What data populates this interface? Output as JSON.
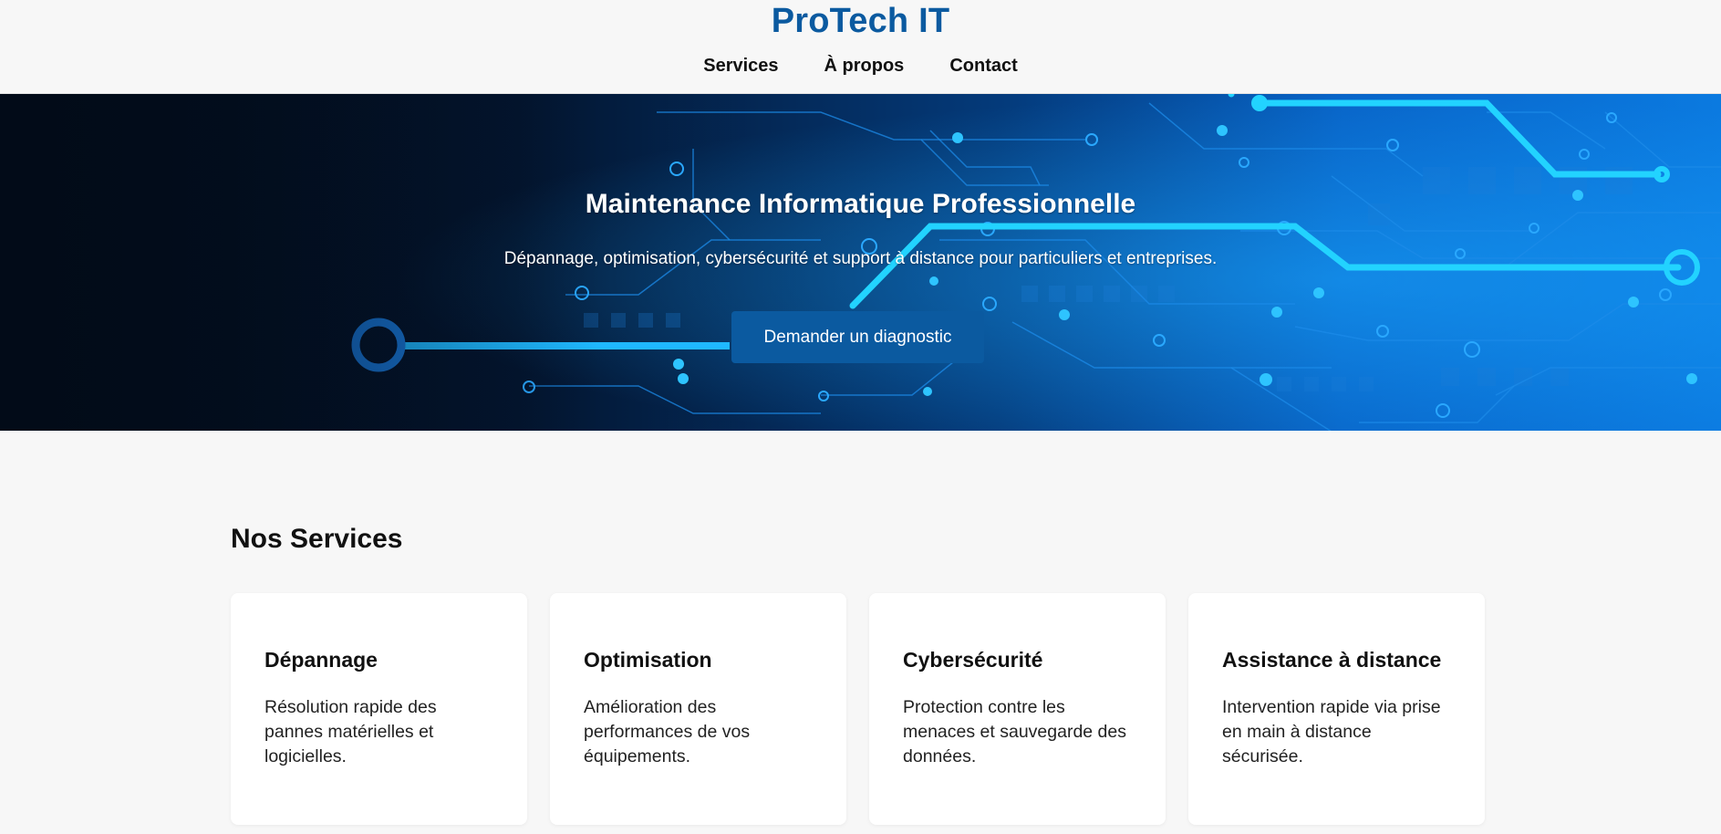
{
  "header": {
    "brand": "ProTech IT",
    "nav": [
      {
        "label": "Services"
      },
      {
        "label": "À propos"
      },
      {
        "label": "Contact"
      }
    ]
  },
  "hero": {
    "title": "Maintenance Informatique Professionnelle",
    "subtitle": "Dépannage, optimisation, cybersécurité et support à distance pour particuliers et entreprises.",
    "cta_label": "Demander un diagnostic",
    "background": "circuit-board-illustration"
  },
  "services": {
    "title": "Nos Services",
    "cards": [
      {
        "title": "Dépannage",
        "text": "Résolution rapide des pannes matérielles et logicielles."
      },
      {
        "title": "Optimisation",
        "text": "Amélioration des performances de vos équipements."
      },
      {
        "title": "Cybersécurité",
        "text": "Protection contre les menaces et sauvegarde des données."
      },
      {
        "title": "Assistance à distance",
        "text": "Intervention rapide via prise en main à distance sécurisée."
      }
    ]
  },
  "colors": {
    "brand": "#0b5aa0",
    "hero_dark": "#020b18",
    "hero_light": "#0b7ae0",
    "circuit_glow": "#22d3ff",
    "page_bg": "#f7f7f7",
    "card_bg": "#ffffff"
  }
}
